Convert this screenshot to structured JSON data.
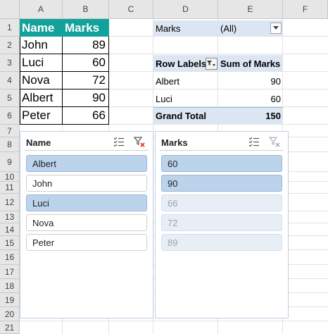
{
  "columns": [
    "A",
    "B",
    "C",
    "D",
    "E",
    "F"
  ],
  "rows": [
    "1",
    "2",
    "3",
    "4",
    "5",
    "6",
    "7",
    "8",
    "9",
    "10",
    "11",
    "12",
    "13",
    "14",
    "15",
    "16",
    "17",
    "18",
    "19",
    "20",
    "21"
  ],
  "table": {
    "headers": [
      "Name",
      "Marks"
    ],
    "rows": [
      {
        "name": "John",
        "marks": "89"
      },
      {
        "name": "Luci",
        "marks": "60"
      },
      {
        "name": "Nova",
        "marks": "72"
      },
      {
        "name": "Albert",
        "marks": "90"
      },
      {
        "name": "Peter",
        "marks": "66"
      }
    ]
  },
  "pivot": {
    "filter_label": "Marks",
    "filter_value": "(All)",
    "row_labels_header": "Row Labels",
    "sum_header": "Sum of Marks",
    "rows": [
      {
        "label": "Albert",
        "value": "90"
      },
      {
        "label": "Luci",
        "value": "60"
      }
    ],
    "grand_total_label": "Grand Total",
    "grand_total_value": "150"
  },
  "slicers": {
    "name": {
      "title": "Name",
      "items": [
        {
          "label": "Albert",
          "state": "selected"
        },
        {
          "label": "John",
          "state": "normal"
        },
        {
          "label": "Luci",
          "state": "selected"
        },
        {
          "label": "Nova",
          "state": "normal"
        },
        {
          "label": "Peter",
          "state": "normal"
        }
      ]
    },
    "marks": {
      "title": "Marks",
      "items": [
        {
          "label": "60",
          "state": "selected"
        },
        {
          "label": "90",
          "state": "selected"
        },
        {
          "label": "66",
          "state": "dim"
        },
        {
          "label": "72",
          "state": "dim"
        },
        {
          "label": "89",
          "state": "dim"
        }
      ]
    }
  },
  "colors": {
    "table_header": "#12a29b",
    "pivot_band": "#dce6f2",
    "slicer_selected": "#bcd3ec",
    "clear_filter_red": "#e0301e"
  },
  "icons": [
    "multi-select-icon",
    "clear-filter-icon",
    "filter-dropdown-icon",
    "dropdown-arrow-icon"
  ]
}
